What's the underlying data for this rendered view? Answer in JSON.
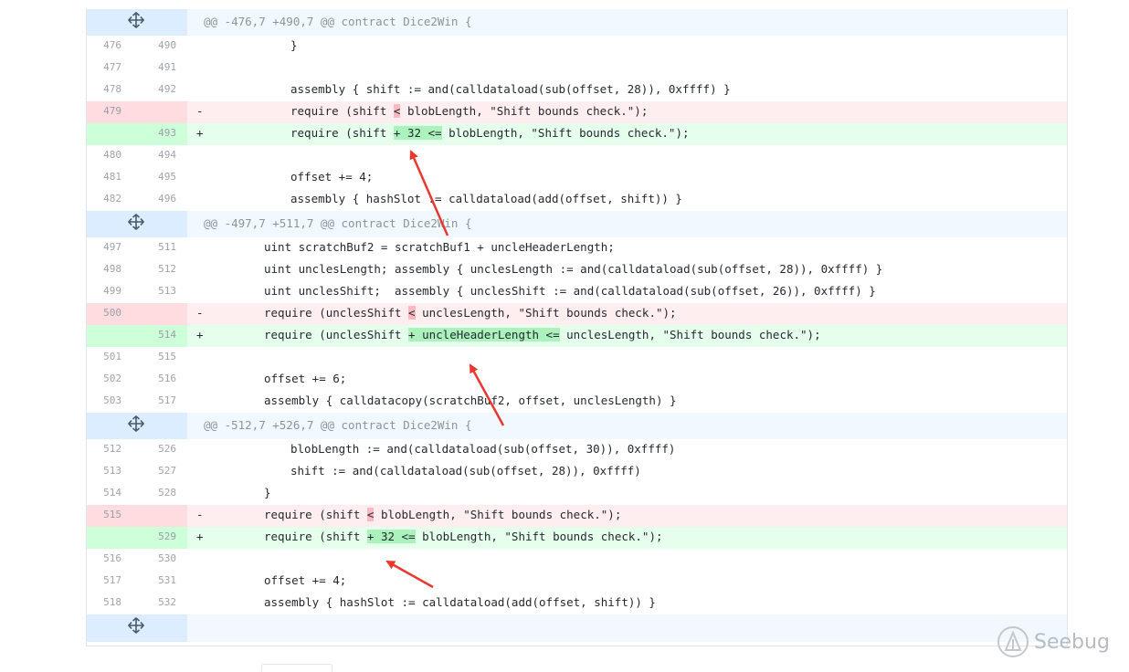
{
  "hunks": [
    {
      "header": "@@ -476,7 +490,7 @@ contract Dice2Win {",
      "lines": [
        {
          "type": "ctx",
          "old": "476",
          "new": "490",
          "sign": "",
          "indent": "i1",
          "text": "}"
        },
        {
          "type": "ctx",
          "old": "477",
          "new": "491",
          "sign": "",
          "indent": "i1",
          "text": ""
        },
        {
          "type": "ctx",
          "old": "478",
          "new": "492",
          "sign": "",
          "indent": "i1",
          "text": "assembly { shift := and(calldataload(sub(offset, 28)), 0xffff) }"
        },
        {
          "type": "del",
          "old": "479",
          "new": "",
          "sign": "-",
          "indent": "i1",
          "pre": "require (shift ",
          "hl": "<",
          "post": " blobLength, \"Shift bounds check.\");"
        },
        {
          "type": "add",
          "old": "",
          "new": "493",
          "sign": "+",
          "indent": "i1",
          "pre": "require (shift ",
          "hl": "+ 32 <=",
          "post": " blobLength, \"Shift bounds check.\");"
        },
        {
          "type": "ctx",
          "old": "480",
          "new": "494",
          "sign": "",
          "indent": "i1",
          "text": ""
        },
        {
          "type": "ctx",
          "old": "481",
          "new": "495",
          "sign": "",
          "indent": "i1",
          "text": "offset += 4;"
        },
        {
          "type": "ctx",
          "old": "482",
          "new": "496",
          "sign": "",
          "indent": "i1",
          "text": "assembly { hashSlot := calldataload(add(offset, shift)) }"
        }
      ]
    },
    {
      "header": "@@ -497,7 +511,7 @@ contract Dice2Win {",
      "lines": [
        {
          "type": "ctx",
          "old": "497",
          "new": "511",
          "sign": "",
          "indent": "i2",
          "text": "uint scratchBuf2 = scratchBuf1 + uncleHeaderLength;"
        },
        {
          "type": "ctx",
          "old": "498",
          "new": "512",
          "sign": "",
          "indent": "i2",
          "text": "uint unclesLength; assembly { unclesLength := and(calldataload(sub(offset, 28)), 0xffff) }"
        },
        {
          "type": "ctx",
          "old": "499",
          "new": "513",
          "sign": "",
          "indent": "i2",
          "text": "uint unclesShift;  assembly { unclesShift := and(calldataload(sub(offset, 26)), 0xffff) }"
        },
        {
          "type": "del",
          "old": "500",
          "new": "",
          "sign": "-",
          "indent": "i2",
          "pre": "require (unclesShift ",
          "hl": "<",
          "post": " unclesLength, \"Shift bounds check.\");"
        },
        {
          "type": "add",
          "old": "",
          "new": "514",
          "sign": "+",
          "indent": "i2",
          "pre": "require (unclesShift ",
          "hl": "+ uncleHeaderLength <=",
          "post": " unclesLength, \"Shift bounds check.\");"
        },
        {
          "type": "ctx",
          "old": "501",
          "new": "515",
          "sign": "",
          "indent": "i2",
          "text": ""
        },
        {
          "type": "ctx",
          "old": "502",
          "new": "516",
          "sign": "",
          "indent": "i2",
          "text": "offset += 6;"
        },
        {
          "type": "ctx",
          "old": "503",
          "new": "517",
          "sign": "",
          "indent": "i2",
          "text": "assembly { calldatacopy(scratchBuf2, offset, unclesLength) }"
        }
      ]
    },
    {
      "header": "@@ -512,7 +526,7 @@ contract Dice2Win {",
      "lines": [
        {
          "type": "ctx",
          "old": "512",
          "new": "526",
          "sign": "",
          "indent": "i1",
          "text": "blobLength := and(calldataload(sub(offset, 30)), 0xffff)"
        },
        {
          "type": "ctx",
          "old": "513",
          "new": "527",
          "sign": "",
          "indent": "i1",
          "text": "shift := and(calldataload(sub(offset, 28)), 0xffff)"
        },
        {
          "type": "ctx",
          "old": "514",
          "new": "528",
          "sign": "",
          "indent": "i2",
          "text": "}"
        },
        {
          "type": "del",
          "old": "515",
          "new": "",
          "sign": "-",
          "indent": "i2",
          "pre": "require (shift ",
          "hl": "<",
          "post": " blobLength, \"Shift bounds check.\");"
        },
        {
          "type": "add",
          "old": "",
          "new": "529",
          "sign": "+",
          "indent": "i2",
          "pre": "require (shift ",
          "hl": "+ 32 <=",
          "post": " blobLength, \"Shift bounds check.\");"
        },
        {
          "type": "ctx",
          "old": "516",
          "new": "530",
          "sign": "",
          "indent": "i2",
          "text": ""
        },
        {
          "type": "ctx",
          "old": "517",
          "new": "531",
          "sign": "",
          "indent": "i2",
          "text": "offset += 4;"
        },
        {
          "type": "ctx",
          "old": "518",
          "new": "532",
          "sign": "",
          "indent": "i2",
          "text": "assembly { hashSlot := calldataload(add(offset, shift)) }"
        }
      ]
    }
  ],
  "expand_icon": "unfold-icon",
  "annotation_color": "#e8382f",
  "watermark": {
    "text": "Seebug"
  }
}
